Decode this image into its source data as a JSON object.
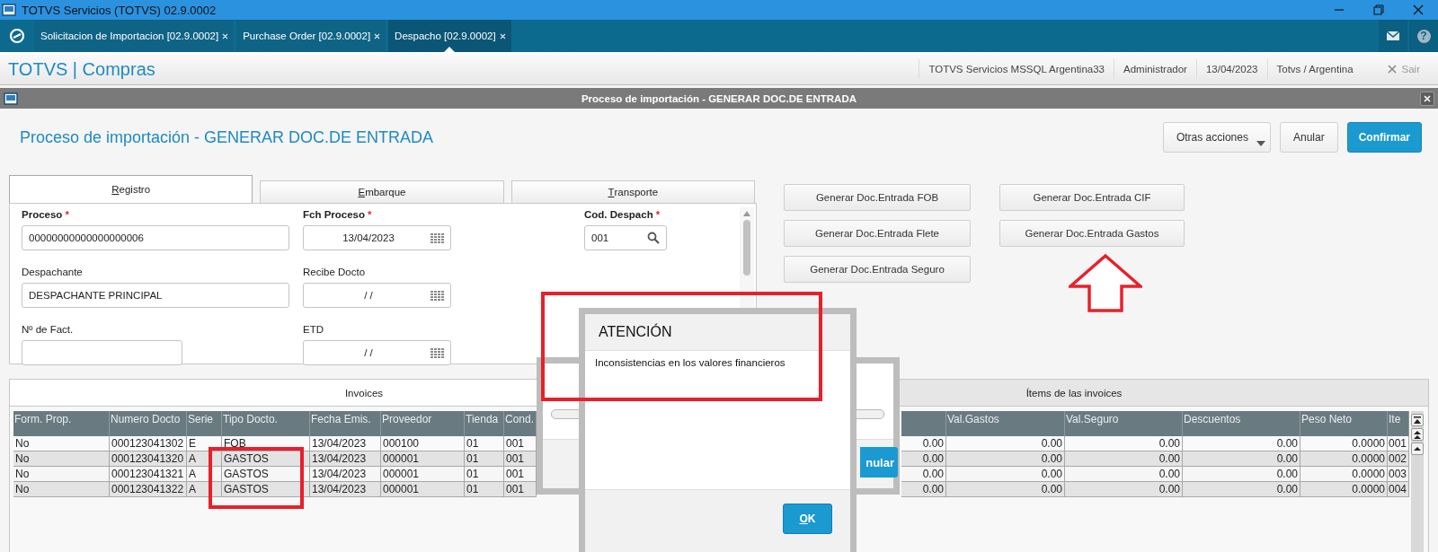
{
  "window": {
    "title": "TOTVS Servicios (TOTVS) 02.9.0002"
  },
  "app_tabs": [
    {
      "label": "Solicitacion de Importacion [02.9.0002]",
      "selected": false
    },
    {
      "label": "Purchase Order [02.9.0002]",
      "selected": false
    },
    {
      "label": "Despacho [02.9.0002]",
      "selected": true
    }
  ],
  "help": "?",
  "header": {
    "brand": "TOTVS | Compras",
    "info": [
      "TOTVS Servicios MSSQL Argentina33",
      "Administrador",
      "13/04/2023",
      "Totvs / Argentina"
    ],
    "exit": "Sair"
  },
  "dialog": {
    "title": "Proceso de importación - GENERAR DOC.DE ENTRADA",
    "heading": "Proceso de importación - GENERAR DOC.DE ENTRADA",
    "actions": [
      {
        "label": "Otras acciones",
        "kind": "menu"
      },
      {
        "label": "Anular",
        "kind": "default"
      },
      {
        "label": "Confirmar",
        "kind": "primary"
      }
    ]
  },
  "form_tabs": [
    {
      "label": "Registro",
      "selected": true
    },
    {
      "label": "Embarque",
      "selected": false
    },
    {
      "label": "Transporte",
      "selected": false
    }
  ],
  "field_rows": [
    [
      {
        "label": "Proceso",
        "required_mark": "*",
        "kind": "text",
        "value": "00000000000000000006"
      },
      {
        "label": "Fch Proceso",
        "required_mark": "*",
        "kind": "date",
        "value": "13/04/2023"
      },
      {
        "label": "Cod. Despach",
        "required_mark": "*",
        "kind": "lookup",
        "value": "001"
      }
    ],
    [
      {
        "label": "Despachante",
        "kind": "text",
        "value": "DESPACHANTE PRINCIPAL"
      },
      {
        "label": "Recibe Docto",
        "kind": "date",
        "value": "/ /"
      }
    ],
    [
      {
        "label": "Nº de Fact.",
        "kind": "text"
      },
      {
        "label": "ETD",
        "kind": "date",
        "value": "/ /"
      }
    ]
  ],
  "generate_buttons": [
    "Generar Doc.Entrada FOB",
    "Generar Doc.Entrada CIF",
    "Generar Doc.Entrada Flete",
    "Generar Doc.Entrada Gastos",
    "Generar Doc.Entrada Seguro"
  ],
  "grid_tabs": [
    {
      "label": "Invoices",
      "selected": true
    },
    {
      "label": "Ítems de las invoices",
      "selected": false
    }
  ],
  "table": {
    "columns": [
      {
        "label": "Form. Prop.",
        "kind": "text"
      },
      {
        "label": "Numero Docto",
        "kind": "text"
      },
      {
        "label": "Serie",
        "kind": "text"
      },
      {
        "label": "Tipo Docto.",
        "kind": "text"
      },
      {
        "label": "Fecha Emis.",
        "kind": "text"
      },
      {
        "label": "Proveedor",
        "kind": "text"
      },
      {
        "label": "Tienda",
        "kind": "text"
      },
      {
        "label": "Cond.",
        "kind": "text"
      },
      {
        "kind": "number"
      },
      {
        "label": "Val.Gastos",
        "kind": "number"
      },
      {
        "label": "Val.Seguro",
        "kind": "number"
      },
      {
        "label": "Descuentos",
        "kind": "number"
      },
      {
        "label": "Peso Neto",
        "kind": "number"
      },
      {
        "label": "Ite",
        "kind": "text"
      }
    ],
    "rows": [
      [
        "No",
        "000123041302",
        "E",
        "FOB",
        "13/04/2023",
        "000100",
        "01",
        "001",
        "0.00",
        "0.00",
        "0.00",
        "0.00",
        "0.0000",
        "001"
      ],
      [
        "No",
        "000123041320",
        "A",
        "GASTOS",
        "13/04/2023",
        "000001",
        "01",
        "001",
        "0.00",
        "0.00",
        "0.00",
        "0.00",
        "0.0000",
        "002"
      ],
      [
        "No",
        "000123041321",
        "A",
        "GASTOS",
        "13/04/2023",
        "000001",
        "01",
        "001",
        "0.00",
        "0.00",
        "0.00",
        "0.00",
        "0.0000",
        "003"
      ],
      [
        "No",
        "000123041322",
        "A",
        "GASTOS",
        "13/04/2023",
        "000001",
        "01",
        "001",
        "0.00",
        "0.00",
        "0.00",
        "0.00",
        "0.0000",
        "004"
      ]
    ]
  },
  "progress": {
    "level": 0,
    "button": "nular"
  },
  "alert": {
    "title": "ATENCIÓN",
    "message": "Inconsistencias en los valores financieros",
    "button": "OK"
  }
}
